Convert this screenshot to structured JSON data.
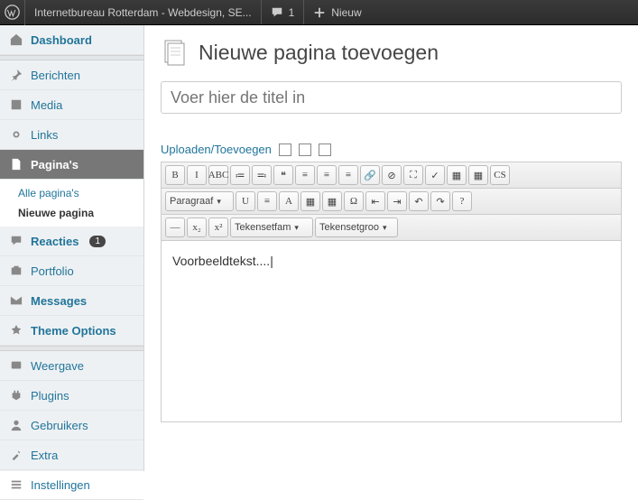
{
  "topbar": {
    "site_name": "Internetbureau Rotterdam - Webdesign, SE...",
    "comment_count": "1",
    "new_label": "Nieuw"
  },
  "sidebar": {
    "dashboard": "Dashboard",
    "posts": "Berichten",
    "media": "Media",
    "links": "Links",
    "pages": "Pagina's",
    "pages_sub": [
      "Alle pagina's",
      "Nieuwe pagina"
    ],
    "comments": "Reacties",
    "comments_badge": "1",
    "portfolio": "Portfolio",
    "messages": "Messages",
    "theme_options": "Theme Options",
    "appearance": "Weergave",
    "plugins": "Plugins",
    "users": "Gebruikers",
    "extra": "Extra",
    "settings": "Instellingen"
  },
  "page": {
    "title": "Nieuwe pagina toevoegen",
    "title_placeholder": "Voer hier de titel in",
    "upload_label": "Uploaden/Toevoegen"
  },
  "editor": {
    "format_select": "Paragraaf",
    "font_family": "Tekensetfam",
    "font_size": "Tekensetgroo",
    "content": "Voorbeeldtekst...."
  },
  "toolbar_row1": [
    "B",
    "I",
    "ABC",
    "≔",
    "≕",
    "❝",
    "≡",
    "≡",
    "≡",
    "🔗",
    "⊘",
    "⛶",
    "✓",
    "▦",
    "▦",
    "CS"
  ],
  "toolbar_row2_mid": [
    "U",
    "≡",
    "A",
    "▦",
    "▦",
    "Ω",
    "⇤",
    "⇥",
    "↶",
    "↷",
    "?"
  ],
  "toolbar_row3": [
    "—",
    "x₂",
    "x²"
  ]
}
